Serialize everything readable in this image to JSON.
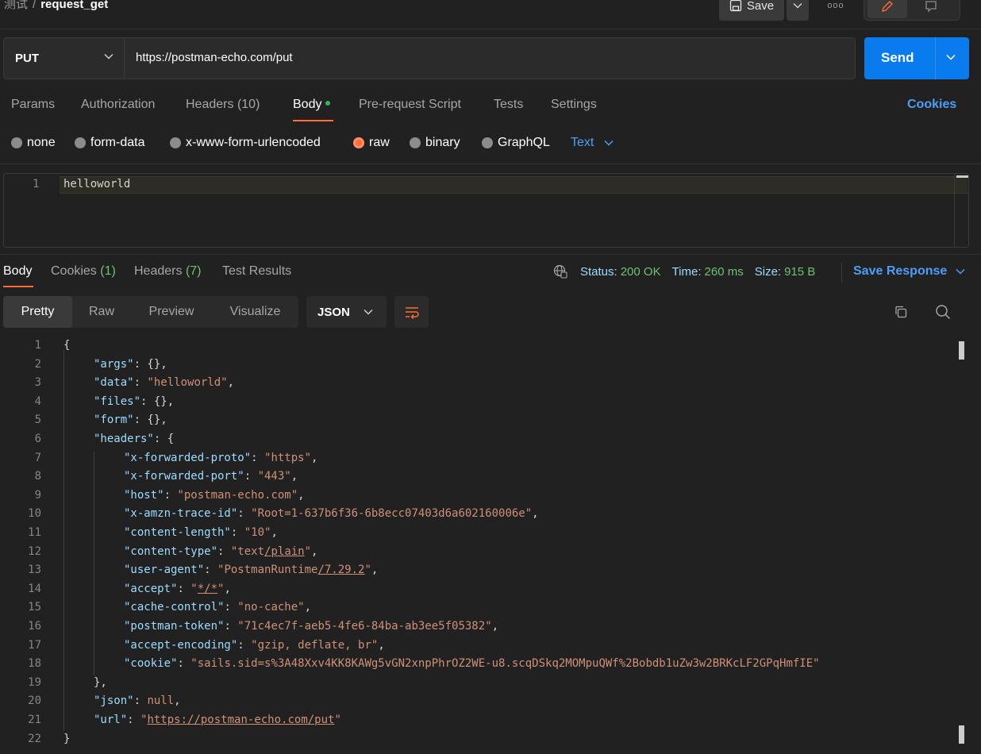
{
  "breadcrumb": {
    "collection": "测试",
    "separator": "/",
    "request": "request_get"
  },
  "top_actions": {
    "save_label": "Save",
    "more": "ooo"
  },
  "request": {
    "method": "PUT",
    "url": "https://postman-echo.com/put",
    "send_label": "Send"
  },
  "request_tabs": {
    "params": "Params",
    "authorization": "Authorization",
    "headers": "Headers",
    "headers_count": "(10)",
    "body": "Body",
    "pre_request": "Pre-request Script",
    "tests": "Tests",
    "settings": "Settings",
    "cookies": "Cookies"
  },
  "body_types": {
    "none": "none",
    "form_data": "form-data",
    "urlencoded": "x-www-form-urlencoded",
    "raw": "raw",
    "binary": "binary",
    "graphql": "GraphQL",
    "selected": "raw",
    "format": "Text"
  },
  "request_body": {
    "line_number": "1",
    "text": "helloworld"
  },
  "response_tabs": {
    "body": "Body",
    "cookies": "Cookies",
    "cookies_count": "(1)",
    "headers": "Headers",
    "headers_count": "(7)",
    "test_results": "Test Results"
  },
  "response_status": {
    "status_label": "Status:",
    "status_value": "200 OK",
    "time_label": "Time:",
    "time_value": "260 ms",
    "size_label": "Size:",
    "size_value": "915 B",
    "save_response": "Save Response"
  },
  "view_tabs": {
    "pretty": "Pretty",
    "raw": "Raw",
    "preview": "Preview",
    "visualize": "Visualize",
    "format": "JSON"
  },
  "response_lines": [
    {
      "n": "1",
      "indent": 0,
      "parts": [
        [
          "p",
          "{"
        ]
      ]
    },
    {
      "n": "2",
      "indent": 1,
      "parts": [
        [
          "k",
          "\"args\""
        ],
        [
          "p",
          ": {},"
        ]
      ]
    },
    {
      "n": "3",
      "indent": 1,
      "parts": [
        [
          "k",
          "\"data\""
        ],
        [
          "p",
          ": "
        ],
        [
          "s",
          "\"helloworld\""
        ],
        [
          "p",
          ","
        ]
      ]
    },
    {
      "n": "4",
      "indent": 1,
      "parts": [
        [
          "k",
          "\"files\""
        ],
        [
          "p",
          ": {},"
        ]
      ]
    },
    {
      "n": "5",
      "indent": 1,
      "parts": [
        [
          "k",
          "\"form\""
        ],
        [
          "p",
          ": {},"
        ]
      ]
    },
    {
      "n": "6",
      "indent": 1,
      "parts": [
        [
          "k",
          "\"headers\""
        ],
        [
          "p",
          ": {"
        ]
      ]
    },
    {
      "n": "7",
      "indent": 2,
      "parts": [
        [
          "k",
          "\"x-forwarded-proto\""
        ],
        [
          "p",
          ": "
        ],
        [
          "s",
          "\"https\""
        ],
        [
          "p",
          ","
        ]
      ]
    },
    {
      "n": "8",
      "indent": 2,
      "parts": [
        [
          "k",
          "\"x-forwarded-port\""
        ],
        [
          "p",
          ": "
        ],
        [
          "s",
          "\"443\""
        ],
        [
          "p",
          ","
        ]
      ]
    },
    {
      "n": "9",
      "indent": 2,
      "parts": [
        [
          "k",
          "\"host\""
        ],
        [
          "p",
          ": "
        ],
        [
          "s",
          "\"postman-echo.com\""
        ],
        [
          "p",
          ","
        ]
      ]
    },
    {
      "n": "10",
      "indent": 2,
      "parts": [
        [
          "k",
          "\"x-amzn-trace-id\""
        ],
        [
          "p",
          ": "
        ],
        [
          "s",
          "\"Root=1-637b6f36-6b8ecc07403d6a602160006e\""
        ],
        [
          "p",
          ","
        ]
      ]
    },
    {
      "n": "11",
      "indent": 2,
      "parts": [
        [
          "k",
          "\"content-length\""
        ],
        [
          "p",
          ": "
        ],
        [
          "s",
          "\"10\""
        ],
        [
          "p",
          ","
        ]
      ]
    },
    {
      "n": "12",
      "indent": 2,
      "parts": [
        [
          "k",
          "\"content-type\""
        ],
        [
          "p",
          ": "
        ],
        [
          "s",
          "\"text"
        ],
        [
          "su",
          "/plain"
        ],
        [
          "s",
          "\""
        ],
        [
          "p",
          ","
        ]
      ]
    },
    {
      "n": "13",
      "indent": 2,
      "parts": [
        [
          "k",
          "\"user-agent\""
        ],
        [
          "p",
          ": "
        ],
        [
          "s",
          "\"PostmanRuntime"
        ],
        [
          "su",
          "/7.29.2"
        ],
        [
          "s",
          "\""
        ],
        [
          "p",
          ","
        ]
      ]
    },
    {
      "n": "14",
      "indent": 2,
      "parts": [
        [
          "k",
          "\"accept\""
        ],
        [
          "p",
          ": "
        ],
        [
          "s",
          "\""
        ],
        [
          "su",
          "*/*"
        ],
        [
          "s",
          "\""
        ],
        [
          "p",
          ","
        ]
      ]
    },
    {
      "n": "15",
      "indent": 2,
      "parts": [
        [
          "k",
          "\"cache-control\""
        ],
        [
          "p",
          ": "
        ],
        [
          "s",
          "\"no-cache\""
        ],
        [
          "p",
          ","
        ]
      ]
    },
    {
      "n": "16",
      "indent": 2,
      "parts": [
        [
          "k",
          "\"postman-token\""
        ],
        [
          "p",
          ": "
        ],
        [
          "s",
          "\"71c4ec7f-aeb5-4fe6-84ba-ab3ee5f05382\""
        ],
        [
          "p",
          ","
        ]
      ]
    },
    {
      "n": "17",
      "indent": 2,
      "parts": [
        [
          "k",
          "\"accept-encoding\""
        ],
        [
          "p",
          ": "
        ],
        [
          "s",
          "\"gzip, deflate, br\""
        ],
        [
          "p",
          ","
        ]
      ]
    },
    {
      "n": "18",
      "indent": 2,
      "parts": [
        [
          "k",
          "\"cookie\""
        ],
        [
          "p",
          ": "
        ],
        [
          "s",
          "\"sails.sid=s%3A48Xxv4KK8KAWg5vGN2xnpPhrOZ2WE-u8.scqDSkq2MOMpuQWf%2Bobdb1uZw3w2BRKcLF2GPqHmfIE\""
        ]
      ]
    },
    {
      "n": "19",
      "indent": 1,
      "parts": [
        [
          "p",
          "},"
        ]
      ]
    },
    {
      "n": "20",
      "indent": 1,
      "parts": [
        [
          "k",
          "\"json\""
        ],
        [
          "p",
          ": "
        ],
        [
          "s",
          "null"
        ],
        [
          "p",
          ","
        ]
      ]
    },
    {
      "n": "21",
      "indent": 1,
      "parts": [
        [
          "k",
          "\"url\""
        ],
        [
          "p",
          ": "
        ],
        [
          "s",
          "\""
        ],
        [
          "su",
          "https://postman-echo.com/put"
        ],
        [
          "s",
          "\""
        ]
      ]
    },
    {
      "n": "22",
      "indent": 0,
      "parts": [
        [
          "p",
          "}"
        ]
      ]
    }
  ]
}
